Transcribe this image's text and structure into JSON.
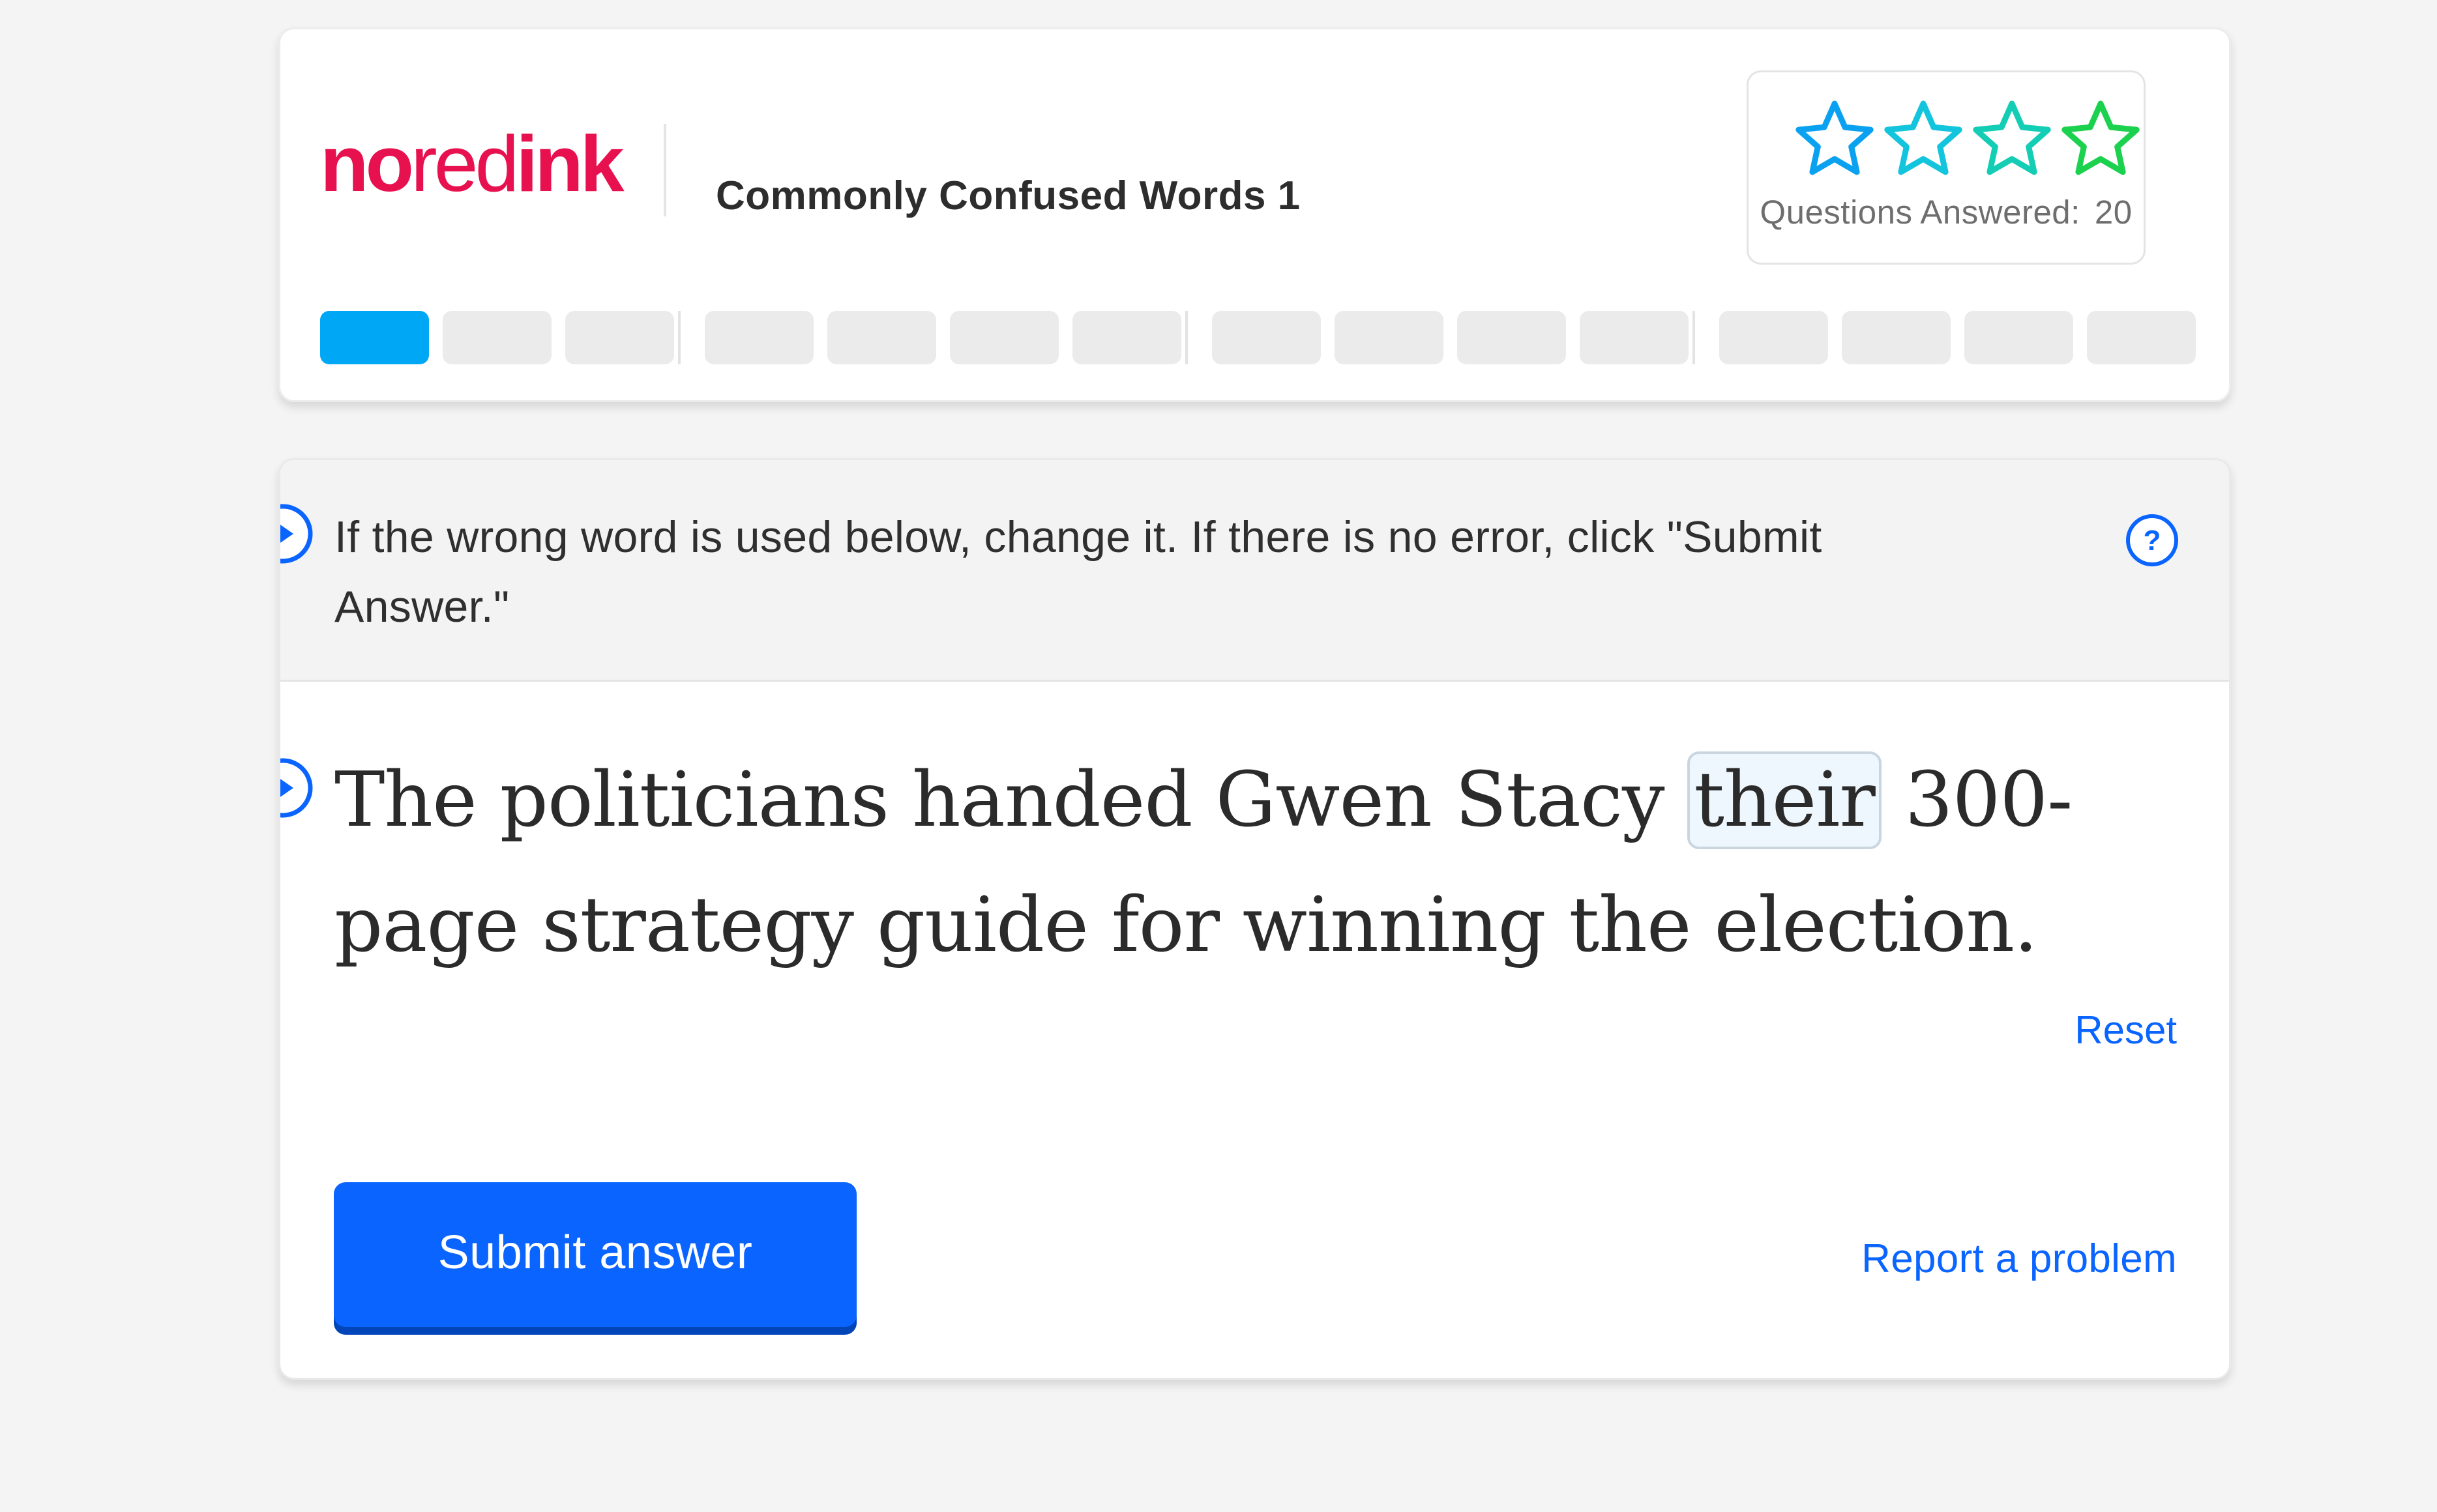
{
  "header": {
    "logo": {
      "part1": "no",
      "part2": "red",
      "part3": "ink"
    },
    "assignment_title": "Commonly Confused Words 1",
    "stars": {
      "earned": 0,
      "total": 4,
      "colors": [
        "#0aa2f0",
        "#13c4dd",
        "#13cdb4",
        "#1cd14e"
      ]
    },
    "questions_answered_label": "Questions Answered:",
    "questions_answered_value": "20",
    "progress": {
      "completed_segments": 1,
      "total_segments": 15,
      "groups": [
        3,
        4,
        4,
        4
      ],
      "active_color": "#00a7f5",
      "inactive_color": "#ebebeb"
    }
  },
  "question": {
    "instructions": "If the wrong word is used below, change it. If there is no error, click \"Submit Answer.\"",
    "sentence_before": "The politicians handed Gwen Stacy ",
    "editable_word": "their",
    "sentence_after": " 300-page strategy guide for winning the election.",
    "reset_label": "Reset",
    "submit_label": "Submit answer",
    "report_label": "Report a problem"
  },
  "icons": {
    "instructions_audio": "play-circle-icon",
    "sentence_audio": "play-circle-icon",
    "help": "question-circle-icon",
    "star": "star-outline-icon"
  },
  "colors": {
    "brand": "#e8114f",
    "link": "#0a64ff",
    "button": "#0a64ff"
  }
}
